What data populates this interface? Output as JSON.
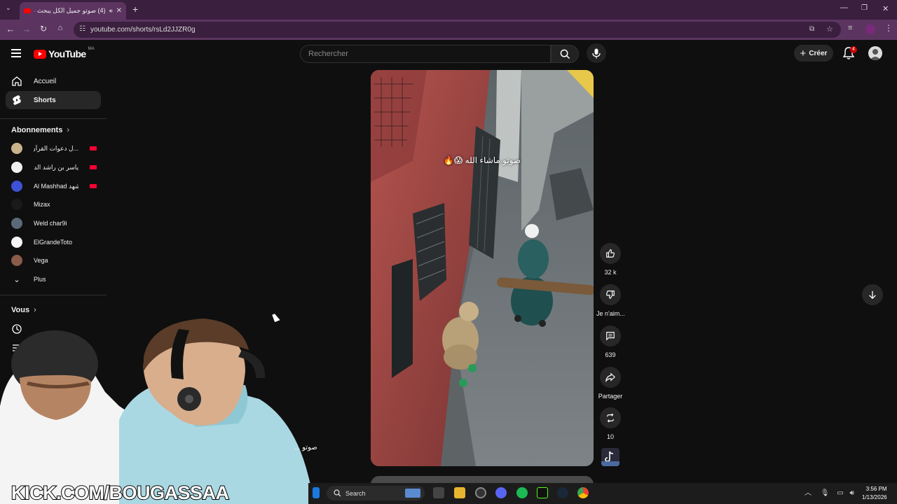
{
  "browser": {
    "tab_title": "(4) صوتو جميل الكل يبحث عنه",
    "url": "youtube.com/shorts/rsLd2JJZR0g"
  },
  "header": {
    "logo_text": "YouTube",
    "country_code": "MA",
    "search_placeholder": "Rechercher",
    "create_label": "Créer",
    "notification_count": "4"
  },
  "sidebar": {
    "home_label": "Accueil",
    "shorts_label": "Shorts",
    "subscriptions_heading": "Abonnements",
    "subscriptions": [
      {
        "name": "...ل دعوات القرآن الكريم",
        "color": "#c9b48a",
        "live": true
      },
      {
        "name": "ياسر بن راشد الدوسري...",
        "color": "#f1f1f1",
        "live": true
      },
      {
        "name": "Al Mashhad المشهد",
        "color": "#3f51d6",
        "live": true
      },
      {
        "name": "Mizax",
        "color": "#1a1a1a",
        "live": false
      },
      {
        "name": "Weld char9i",
        "color": "#5a6a7a",
        "live": false
      },
      {
        "name": "ElGrandeToto",
        "color": "#f5f5f5",
        "live": false
      },
      {
        "name": "Vega",
        "color": "#8a5a4a",
        "live": false
      }
    ],
    "more_label": "Plus",
    "you_heading": "Vous"
  },
  "short": {
    "caption": "صوتو ماشاء الله 😱🔥",
    "likes": "32 k",
    "dislike_label": "Je n'aim...",
    "comments": "639",
    "share_label": "Partager",
    "remix_count": "10"
  },
  "overlay": {
    "cam_caption": "صوتو ...",
    "kick_handle": "KICK.COM/BOUGASSAA"
  },
  "taskbar": {
    "search_label": "Search",
    "time": "3:56 PM",
    "date": "1/13/2026"
  }
}
